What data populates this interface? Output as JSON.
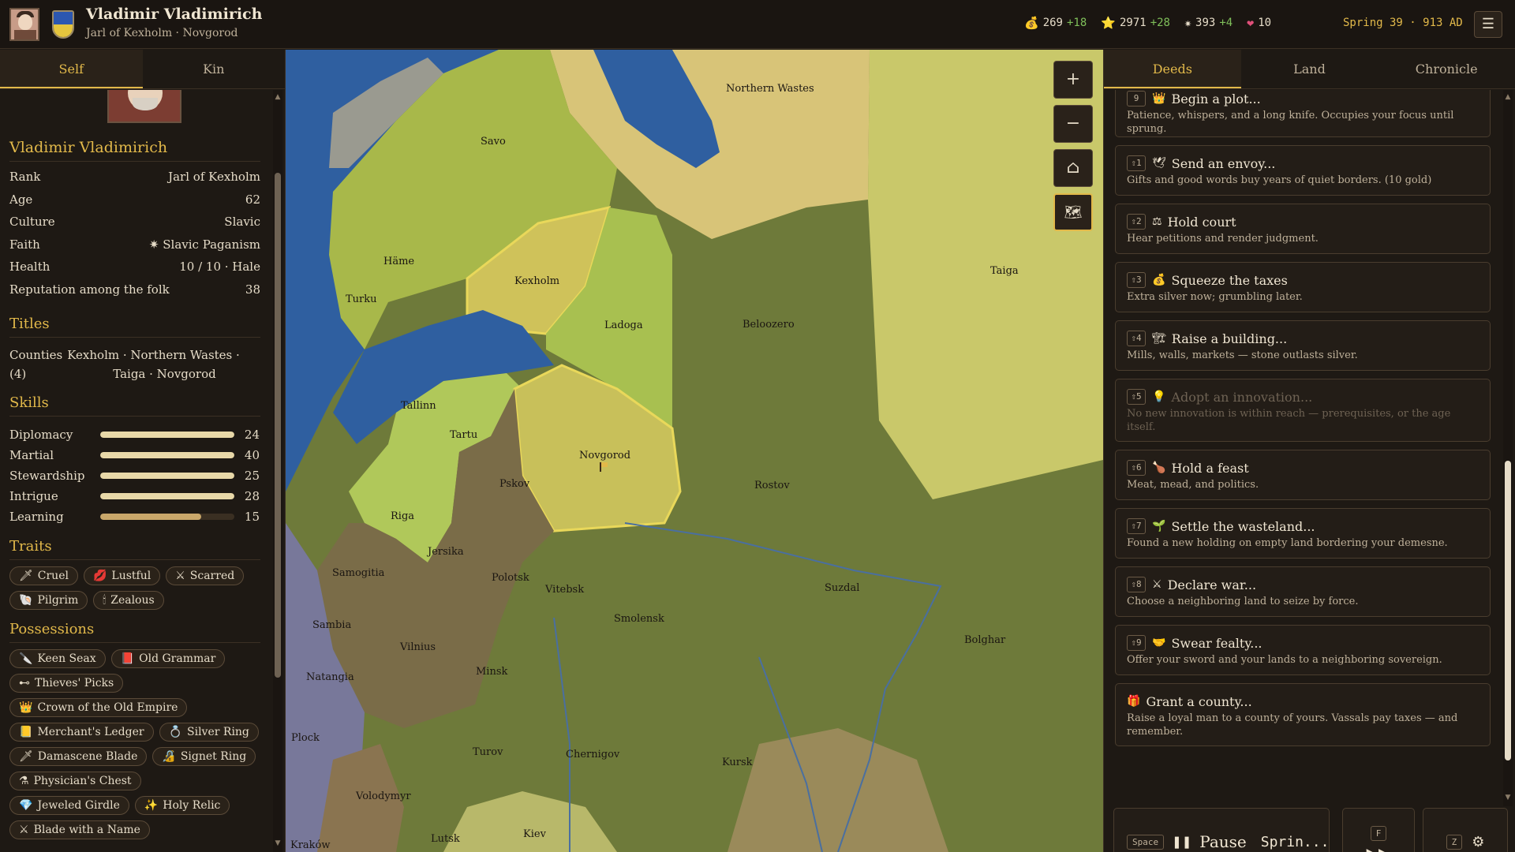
{
  "header": {
    "name": "Vladimir Vladimirich",
    "subtitle": "Jarl of Kexholm · Novgorod",
    "resources": [
      {
        "icon": "💰",
        "icon_name": "gold-icon",
        "value": "269",
        "delta": "+18"
      },
      {
        "icon": "⭐",
        "icon_name": "prestige-icon",
        "value": "2971",
        "delta": "+28"
      },
      {
        "icon": "✷",
        "icon_name": "piety-icon",
        "value": "393",
        "delta": "+4"
      },
      {
        "icon": "❤",
        "icon_name": "health-icon",
        "value": "10",
        "delta": ""
      }
    ],
    "date": "Spring 39 · 913 AD",
    "menu_icon": "☰"
  },
  "left": {
    "tabs": [
      "Self",
      "Kin"
    ],
    "char_name": "Vladimir Vladimirich",
    "stats": [
      {
        "label": "Rank",
        "value": "Jarl of Kexholm"
      },
      {
        "label": "Age",
        "value": "62"
      },
      {
        "label": "Culture",
        "value": "Slavic"
      },
      {
        "label": "Faith",
        "value": "✷ Slavic Paganism"
      },
      {
        "label": "Health",
        "value": "10 / 10 · Hale"
      },
      {
        "label": "Reputation among the folk",
        "value": "38"
      }
    ],
    "titles_head": "Titles",
    "titles_label_1": "Counties",
    "titles_label_2": "(4)",
    "titles_line_1": "Kexholm · Northern Wastes ·",
    "titles_line_2": "Taiga · Novgorod",
    "skills_head": "Skills",
    "skills": [
      {
        "name": "Diplomacy",
        "value": "24",
        "fill": 1.0
      },
      {
        "name": "Martial",
        "value": "40",
        "fill": 1.0
      },
      {
        "name": "Stewardship",
        "value": "25",
        "fill": 1.0
      },
      {
        "name": "Intrigue",
        "value": "28",
        "fill": 1.0
      },
      {
        "name": "Learning",
        "value": "15",
        "fill": 0.75
      }
    ],
    "traits_head": "Traits",
    "traits": [
      {
        "icon": "🗡",
        "icon_name": "dagger-icon",
        "label": "Cruel"
      },
      {
        "icon": "💋",
        "icon_name": "lips-icon",
        "label": "Lustful"
      },
      {
        "icon": "⚔",
        "icon_name": "crossed-swords-icon",
        "label": "Scarred"
      },
      {
        "icon": "🐚",
        "icon_name": "shell-icon",
        "label": "Pilgrim"
      },
      {
        "icon": "🕯",
        "icon_name": "candle-icon",
        "label": "Zealous"
      }
    ],
    "possessions_head": "Possessions",
    "possessions": [
      {
        "icon": "🔪",
        "icon_name": "knife-icon",
        "label": "Keen Seax"
      },
      {
        "icon": "📕",
        "icon_name": "book-icon",
        "label": "Old Grammar"
      },
      {
        "icon": "⊷",
        "icon_name": "lockpick-icon",
        "label": "Thieves' Picks"
      },
      {
        "icon": "👑",
        "icon_name": "crown-icon",
        "label": "Crown of the Old Empire"
      },
      {
        "icon": "📒",
        "icon_name": "ledger-icon",
        "label": "Merchant's Ledger"
      },
      {
        "icon": "💍",
        "icon_name": "ring-icon",
        "label": "Silver Ring"
      },
      {
        "icon": "🗡",
        "icon_name": "blade-icon",
        "label": "Damascene Blade"
      },
      {
        "icon": "🔏",
        "icon_name": "signet-icon",
        "label": "Signet Ring"
      },
      {
        "icon": "⚗",
        "icon_name": "chest-icon",
        "label": "Physician's Chest"
      },
      {
        "icon": "💎",
        "icon_name": "gem-icon",
        "label": "Jeweled Girdle"
      },
      {
        "icon": "✨",
        "icon_name": "relic-icon",
        "label": "Holy Relic"
      },
      {
        "icon": "⚔",
        "icon_name": "sword-icon",
        "label": "Blade with a Name"
      }
    ]
  },
  "map": {
    "labels": [
      {
        "text": "Northern Wastes"
      },
      {
        "text": "Savo"
      },
      {
        "text": "Häme"
      },
      {
        "text": "Turku"
      },
      {
        "text": "Kexholm"
      },
      {
        "text": "Ladoga"
      },
      {
        "text": "Beloozero"
      },
      {
        "text": "Taiga"
      },
      {
        "text": "Tallinn"
      },
      {
        "text": "Tartu"
      },
      {
        "text": "Novgorod"
      },
      {
        "text": "Pskov"
      },
      {
        "text": "Rostov"
      },
      {
        "text": "Riga"
      },
      {
        "text": "Jersika"
      },
      {
        "text": "Samogitia"
      },
      {
        "text": "Polotsk"
      },
      {
        "text": "Vitebsk"
      },
      {
        "text": "Smolensk"
      },
      {
        "text": "Suzdal"
      },
      {
        "text": "Bolghar"
      },
      {
        "text": "Sambia"
      },
      {
        "text": "Vilnius"
      },
      {
        "text": "Natangia"
      },
      {
        "text": "Minsk"
      },
      {
        "text": "Plock"
      },
      {
        "text": "Turov"
      },
      {
        "text": "Chernigov"
      },
      {
        "text": "Kursk"
      },
      {
        "text": "Volodymyr"
      },
      {
        "text": "Kraków"
      },
      {
        "text": "Lutsk"
      },
      {
        "text": "Kiev"
      }
    ],
    "zoom_in": "+",
    "zoom_out": "−",
    "home": "⌂",
    "overview": "🗺"
  },
  "right": {
    "tabs": [
      "Deeds",
      "Land",
      "Chronicle"
    ],
    "deeds": [
      {
        "key": "9",
        "icon": "👑",
        "icon_name": "plot-icon",
        "title": "Begin a plot...",
        "desc": "Patience, whispers, and a long knife. Occupies your focus until sprung.",
        "disabled": false
      },
      {
        "key": "⇧1",
        "icon": "🕊",
        "icon_name": "envoy-icon",
        "title": "Send an envoy...",
        "desc": "Gifts and good words buy years of quiet borders. (10 gold)",
        "disabled": false
      },
      {
        "key": "⇧2",
        "icon": "⚖",
        "icon_name": "court-icon",
        "title": "Hold court",
        "desc": "Hear petitions and render judgment.",
        "disabled": false
      },
      {
        "key": "⇧3",
        "icon": "💰",
        "icon_name": "taxes-icon",
        "title": "Squeeze the taxes",
        "desc": "Extra silver now; grumbling later.",
        "disabled": false
      },
      {
        "key": "⇧4",
        "icon": "🏗",
        "icon_name": "building-icon",
        "title": "Raise a building...",
        "desc": "Mills, walls, markets — stone outlasts silver.",
        "disabled": false
      },
      {
        "key": "⇧5",
        "icon": "💡",
        "icon_name": "innovation-icon",
        "title": "Adopt an innovation...",
        "desc": "No new innovation is within reach — prerequisites, or the age itself.",
        "disabled": true
      },
      {
        "key": "⇧6",
        "icon": "🍗",
        "icon_name": "feast-icon",
        "title": "Hold a feast",
        "desc": "Meat, mead, and politics.",
        "disabled": false
      },
      {
        "key": "⇧7",
        "icon": "🌱",
        "icon_name": "settle-icon",
        "title": "Settle the wasteland...",
        "desc": "Found a new holding on empty land bordering your demesne.",
        "disabled": false
      },
      {
        "key": "⇧8",
        "icon": "⚔",
        "icon_name": "war-icon",
        "title": "Declare war...",
        "desc": "Choose a neighboring land to seize by force.",
        "disabled": false
      },
      {
        "key": "⇧9",
        "icon": "🤝",
        "icon_name": "fealty-icon",
        "title": "Swear fealty...",
        "desc": "Offer your sword and your lands to a neighboring sovereign.",
        "disabled": false
      },
      {
        "key": "",
        "icon": "🎁",
        "icon_name": "grant-icon",
        "title": "Grant a county...",
        "desc": "Raise a loyal man to a county of yours. Vassals pay taxes — and remember.",
        "disabled": false
      }
    ],
    "pause_key": "Space",
    "pause_icon": "❚❚",
    "pause_label": "Pause",
    "pause_season": "Sprin...",
    "ff_key": "F",
    "ff_icon": "▶▶",
    "settings_key": "Z",
    "settings_icon": "⚙"
  },
  "colors": {
    "accent": "#e2b94a",
    "sea": "#2f5fa0",
    "own_realm": "#c8c05a",
    "dark_land": "#6e7a3a",
    "brown_land": "#7a6c48"
  }
}
